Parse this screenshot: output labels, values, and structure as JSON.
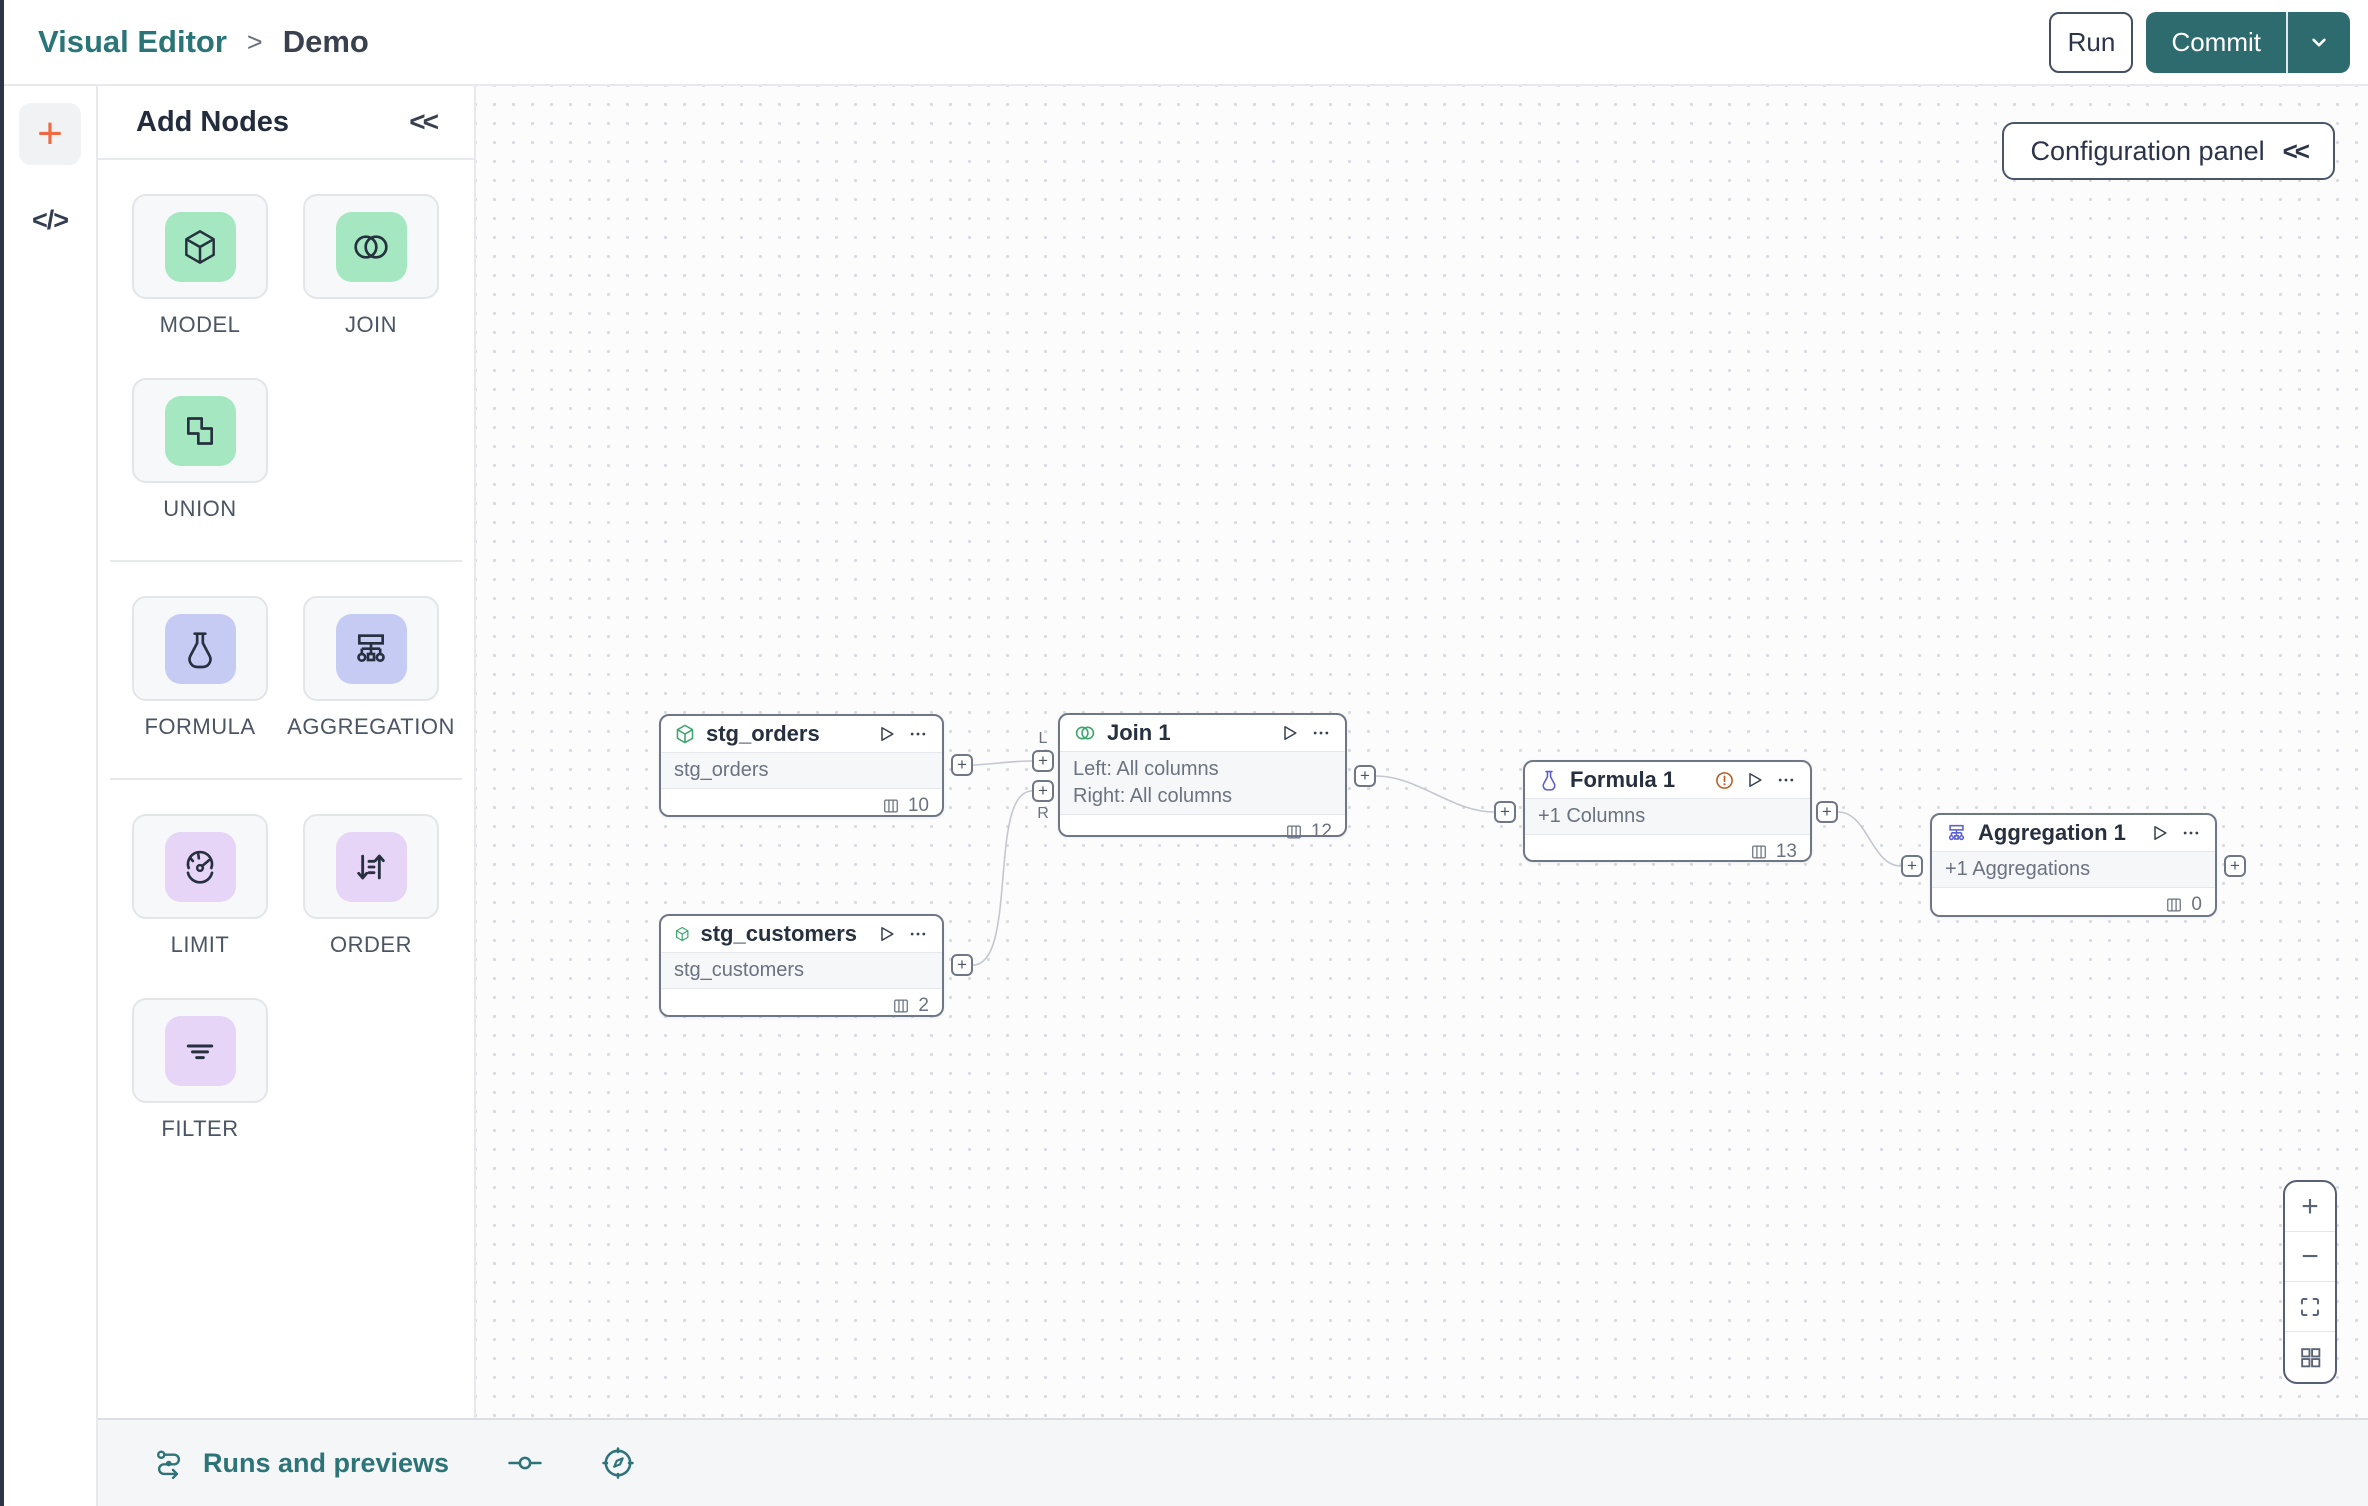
{
  "header": {
    "breadcrumb": {
      "root": "Visual Editor",
      "separator": ">",
      "current": "Demo"
    },
    "run_label": "Run",
    "commit_label": "Commit"
  },
  "rail": {
    "add_glyph": "+",
    "code_glyph": "</>"
  },
  "panel": {
    "title": "Add Nodes",
    "collapse_glyph": "<<",
    "groups": [
      {
        "items": [
          {
            "label": "MODEL"
          },
          {
            "label": "JOIN"
          },
          {
            "label": "UNION"
          }
        ]
      },
      {
        "items": [
          {
            "label": "FORMULA"
          },
          {
            "label": "AGGREGATION"
          }
        ]
      },
      {
        "items": [
          {
            "label": "LIMIT"
          },
          {
            "label": "ORDER"
          },
          {
            "label": "FILTER"
          }
        ]
      }
    ]
  },
  "canvas": {
    "config_panel": {
      "label": "Configuration panel",
      "collapse_glyph": "<<"
    },
    "port_glyph": "+",
    "nodes": [
      {
        "title": "stg_orders",
        "body_lines": [
          "stg_orders"
        ],
        "column_count": "10"
      },
      {
        "title": "stg_customers",
        "body_lines": [
          "stg_customers"
        ],
        "column_count": "2"
      },
      {
        "title": "Join 1",
        "body_lines": [
          "Left: All columns",
          "Right: All columns"
        ],
        "column_count": "12",
        "input_labels": [
          "L",
          "R"
        ]
      },
      {
        "title": "Formula 1",
        "body_lines": [
          "+1 Columns"
        ],
        "column_count": "13"
      },
      {
        "title": "Aggregation 1",
        "body_lines": [
          "+1 Aggregations"
        ],
        "column_count": "0"
      }
    ]
  },
  "zoom_controls": {
    "zoom_in_glyph": "+",
    "zoom_out_glyph": "−"
  },
  "bottom_bar": {
    "runs_label": "Runs and previews"
  },
  "colors": {
    "teal_brand": "#2a7578",
    "teal_button": "#2e6b6e",
    "orange_accent": "#ed6a45",
    "warning_orange": "#bf5b21",
    "green_icon": "#3aa56c",
    "indigo_icon": "#5a5fd0",
    "tile_green": "#a4e7c0",
    "tile_indigo": "#c6cbf4",
    "tile_purple": "#e6d5f7",
    "edge_gray": "#c4c7cf"
  }
}
